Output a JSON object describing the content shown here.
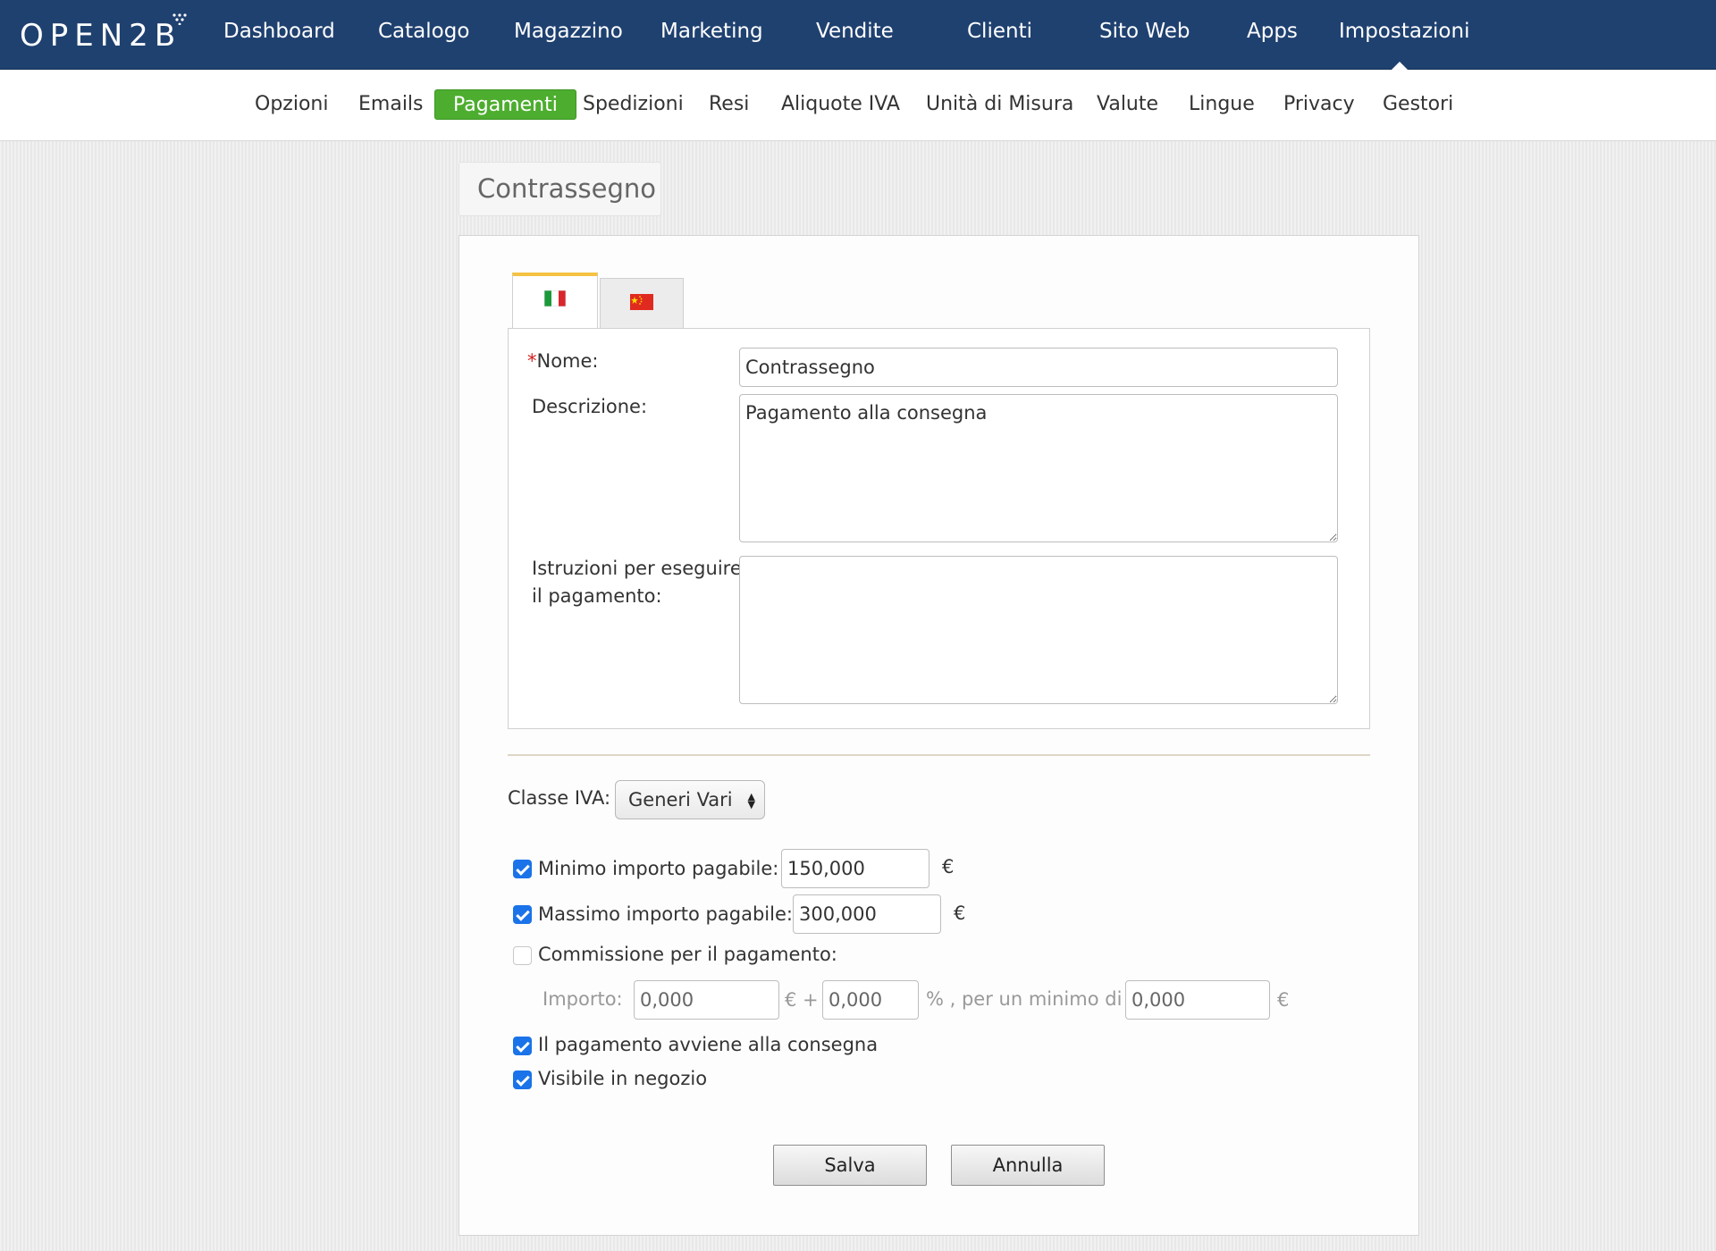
{
  "app": {
    "logo": "OPEN2B"
  },
  "topnav": [
    {
      "id": "dashboard",
      "label": "Dashboard"
    },
    {
      "id": "catalogo",
      "label": "Catalogo"
    },
    {
      "id": "magazzino",
      "label": "Magazzino"
    },
    {
      "id": "marketing",
      "label": "Marketing"
    },
    {
      "id": "vendite",
      "label": "Vendite"
    },
    {
      "id": "clienti",
      "label": "Clienti"
    },
    {
      "id": "sito-web",
      "label": "Sito Web"
    },
    {
      "id": "apps",
      "label": "Apps"
    },
    {
      "id": "impostazioni",
      "label": "Impostazioni",
      "active": true
    }
  ],
  "subnav": [
    {
      "id": "opzioni",
      "label": "Opzioni"
    },
    {
      "id": "emails",
      "label": "Emails"
    },
    {
      "id": "pagamenti",
      "label": "Pagamenti",
      "active": true
    },
    {
      "id": "spedizioni",
      "label": "Spedizioni"
    },
    {
      "id": "resi",
      "label": "Resi"
    },
    {
      "id": "aliquote-iva",
      "label": "Aliquote IVA"
    },
    {
      "id": "unita-di-misura",
      "label": "Unità di Misura"
    },
    {
      "id": "valute",
      "label": "Valute"
    },
    {
      "id": "lingue",
      "label": "Lingue"
    },
    {
      "id": "privacy",
      "label": "Privacy"
    },
    {
      "id": "gestori",
      "label": "Gestori"
    }
  ],
  "page": {
    "title": "Contrassegno"
  },
  "tabs": [
    {
      "id": "it",
      "icon": "flag-italy-icon",
      "active": true
    },
    {
      "id": "cn",
      "icon": "flag-china-icon",
      "active": false
    }
  ],
  "form": {
    "required_mark": "*",
    "nome_label": "Nome:",
    "nome_value": "Contrassegno",
    "descrizione_label": "Descrizione:",
    "descrizione_value": "Pagamento alla consegna",
    "istruzioni_label_line1": "Istruzioni per eseguire",
    "istruzioni_label_line2": "il pagamento:",
    "istruzioni_value": "",
    "classe_iva_label": "Classe IVA:",
    "classe_iva_value": "Generi Vari",
    "minimo_label": "Minimo importo pagabile:",
    "minimo_value": "150,000",
    "minimo_checked": true,
    "massimo_label": "Massimo importo pagabile:",
    "massimo_value": "300,000",
    "massimo_checked": true,
    "currency": "€",
    "commissione_label": "Commissione per il pagamento:",
    "commissione_checked": false,
    "importo_label": "Importo:",
    "importo_value": "0,000",
    "plus_sep": "€ +",
    "percent_value": "0,000",
    "percent_sep": "% , per un minimo di",
    "minimo_commissione_value": "0,000",
    "consegna_label": "Il pagamento avviene alla consegna",
    "consegna_checked": true,
    "visibile_label": "Visibile in negozio",
    "visibile_checked": true
  },
  "buttons": {
    "save": "Salva",
    "cancel": "Annulla"
  },
  "colors": {
    "topbar": "#1f4170",
    "active_tab": "#4dad2f",
    "tab_accent": "#f5c242",
    "checkbox": "#1a73e8",
    "required": "#d2201c"
  }
}
